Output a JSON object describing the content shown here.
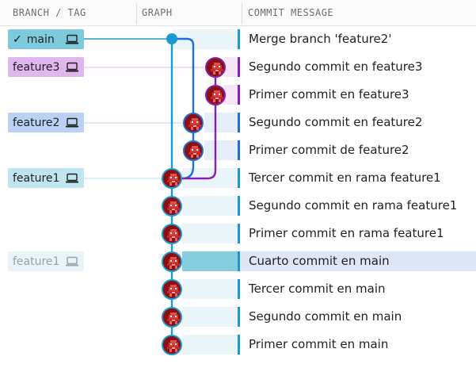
{
  "header": {
    "branch_col": "BRANCH / TAG",
    "graph_col": "GRAPH",
    "message_col": "COMMIT MESSAGE"
  },
  "branches": [
    {
      "name": "main",
      "checked": true,
      "color": "#7ccbdc"
    },
    {
      "name": "feature3",
      "checked": false,
      "color": "#e0b6ee"
    },
    {
      "name": "feature2",
      "checked": false,
      "color": "#b7d2f2"
    },
    {
      "name": "feature1",
      "checked": false,
      "color": "#bfe6ee"
    },
    {
      "name": "feature1",
      "checked": false,
      "color": "#e8f4f7",
      "faded": true
    }
  ],
  "commits": [
    {
      "message": "Merge branch 'feature2'"
    },
    {
      "message": "Segundo commit en feature3"
    },
    {
      "message": "Primer commit en feature3"
    },
    {
      "message": "Segundo commit en feature2"
    },
    {
      "message": "Primer commit de feature2"
    },
    {
      "message": "Tercer commit en rama feature1"
    },
    {
      "message": "Segundo commit en rama feature1"
    },
    {
      "message": "Primer commit en rama feature1"
    },
    {
      "message": "Cuarto commit en main"
    },
    {
      "message": "Tercer commit en main"
    },
    {
      "message": "Segundo commit en main"
    },
    {
      "message": "Primer commit en main"
    }
  ],
  "colors": {
    "main_lane": "#1a9ad0",
    "feature2_lane": "#1e6fd9",
    "feature3_lane": "#8a1fb8",
    "selected_row": "#dfe7f7"
  },
  "icons": {
    "checkmark": "check-icon",
    "laptop": "laptop-icon",
    "avatar": "pixel-avatar-icon"
  }
}
